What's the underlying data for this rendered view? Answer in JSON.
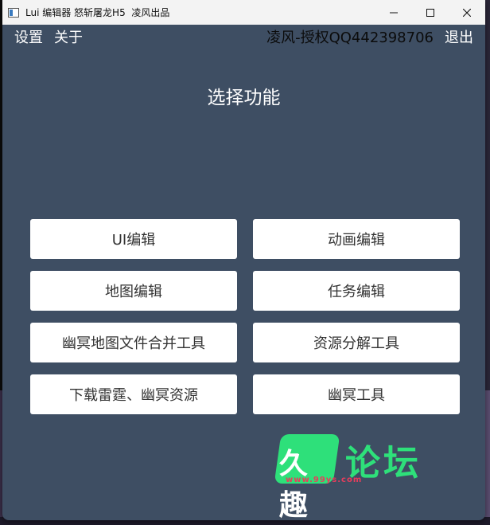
{
  "window": {
    "title": "Lui 编辑器 怒斩屠龙H5  凌风出品"
  },
  "menu": {
    "settings": "设置",
    "about": "关于",
    "license": "凌风-授权QQ442398706",
    "exit": "退出"
  },
  "main": {
    "heading": "选择功能",
    "buttons": [
      {
        "label": "UI编辑"
      },
      {
        "label": "动画编辑"
      },
      {
        "label": "地图编辑"
      },
      {
        "label": "任务编辑"
      },
      {
        "label": "幽冥地图文件合并工具"
      },
      {
        "label": "资源分解工具"
      },
      {
        "label": "下载雷霆、幽冥资源"
      },
      {
        "label": "幽冥工具"
      }
    ]
  },
  "watermark": {
    "logo_text": "久趣",
    "forum_text": "论坛",
    "url": "www.99ys.com"
  },
  "colors": {
    "window_bg": "#3e4e63",
    "button_bg": "#ffffff",
    "button_text": "#333333",
    "watermark_green": "#2ee07a",
    "watermark_red": "#e83d5c"
  }
}
